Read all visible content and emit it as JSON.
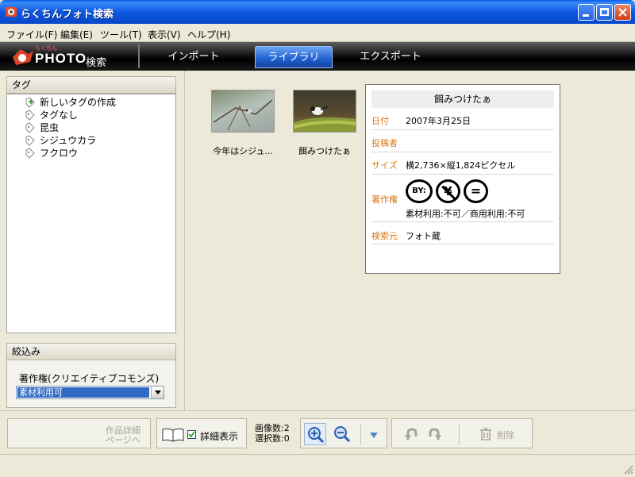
{
  "window": {
    "title": "らくちんフォト検索"
  },
  "menu": [
    "ファイル(F)",
    "編集(E)",
    "ツール(T)",
    "表示(V)",
    "ヘルプ(H)"
  ],
  "logo": {
    "small": "らくちん",
    "main": "PHOTO",
    "suffix": "検索"
  },
  "tabs": {
    "import": "インポート",
    "library": "ライブラリ",
    "export": "エクスポート"
  },
  "tag_panel": {
    "title": "タグ",
    "items": [
      "新しいタグの作成",
      "タグなし",
      "昆虫",
      "シジュウカラ",
      "フクロウ"
    ]
  },
  "filter_panel": {
    "title": "絞込み",
    "label": "著作権(クリエイティブコモンズ)",
    "selected": "素材利用可"
  },
  "photos": [
    {
      "label": "今年はシジュ..."
    },
    {
      "label": "餌みつけたぁ"
    }
  ],
  "detail": {
    "title": "餌みつけたぁ",
    "date_label": "日付",
    "date_value": "2007年3月25日",
    "poster_label": "投稿者",
    "poster_value": "",
    "size_label": "サイズ",
    "size_value": "横2,736×縦1,824ピクセル",
    "copyright_label": "著作権",
    "license_badges": [
      "BY:",
      "¥",
      "="
    ],
    "copyright_text": "素材利用:不可／商用利用:不可",
    "source_label": "検索元",
    "source_value": "フォト蔵"
  },
  "toolbar": {
    "work_detail_line1": "作品詳細",
    "work_detail_line2": "ページへ",
    "detail_view_label": "詳細表示",
    "detail_view_checked": true,
    "image_count": "画像数:2",
    "selected_count": "選択数:0",
    "delete_label": "削除"
  }
}
